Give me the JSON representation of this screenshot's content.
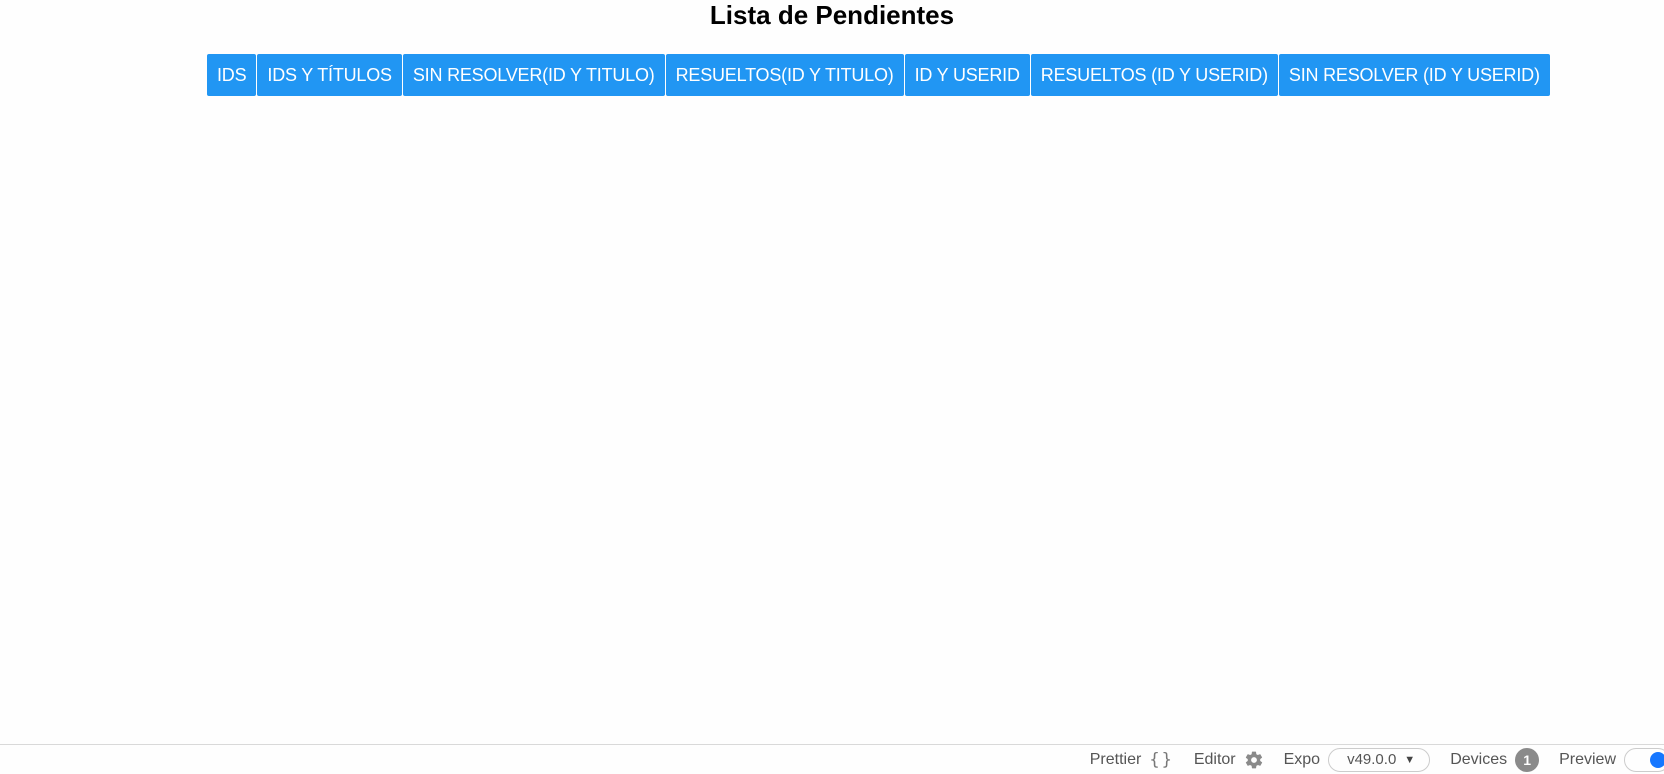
{
  "page": {
    "title": "Lista de Pendientes"
  },
  "filters": {
    "buttons": [
      {
        "label": "IDS"
      },
      {
        "label": "IDS Y TÍTULOS"
      },
      {
        "label": "SIN RESOLVER(ID Y TITULO)"
      },
      {
        "label": "RESUELTOS(ID Y TITULO)"
      },
      {
        "label": "ID Y USERID"
      },
      {
        "label": "RESUELTOS (ID Y USERID)"
      },
      {
        "label": "SIN RESOLVER (ID Y USERID)"
      }
    ]
  },
  "footer": {
    "prettier_label": "Prettier",
    "prettier_icon": "{}",
    "editor_label": "Editor",
    "expo_label": "Expo",
    "expo_version": "v49.0.0",
    "devices_label": "Devices",
    "devices_count": "1",
    "preview_label": "Preview",
    "preview_enabled": true
  },
  "colors": {
    "button_bg": "#2196f3",
    "toggle_on": "#1677ff",
    "badge_bg": "#8a8a8a"
  }
}
